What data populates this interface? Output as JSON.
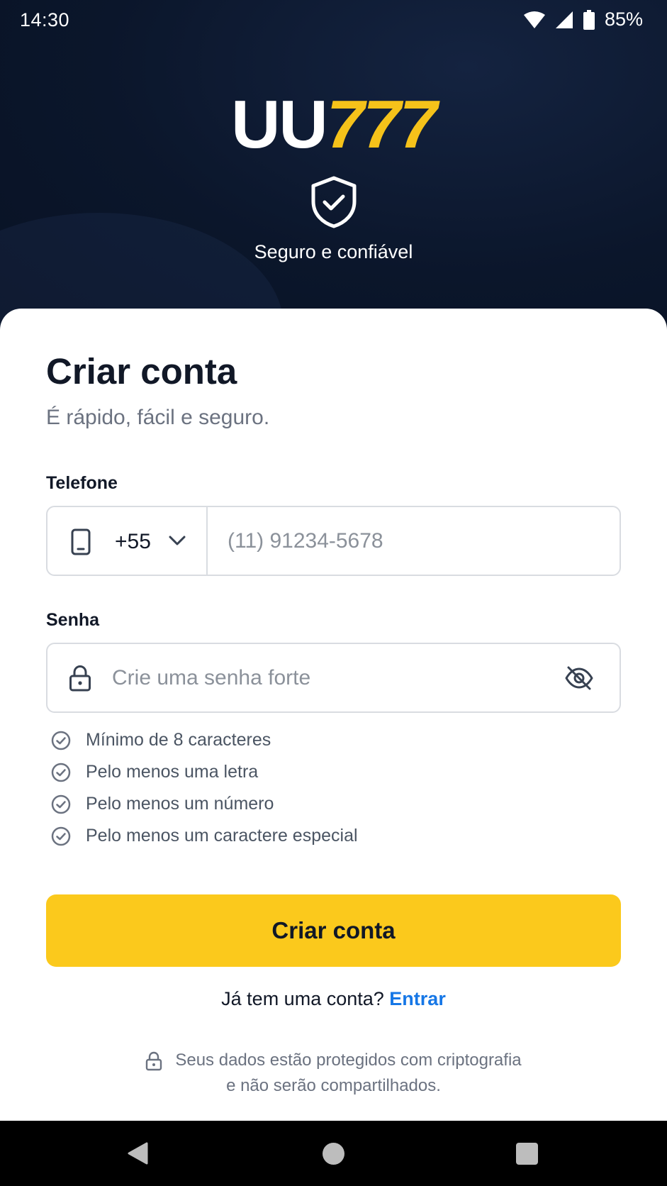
{
  "status_bar": {
    "time": "14:30",
    "battery": "85%",
    "icons": [
      "wifi-icon",
      "signal-icon",
      "battery-icon"
    ]
  },
  "header": {
    "logo_white": "UU",
    "logo_yellow": "777",
    "tagline": "Seguro e confiável",
    "icon": "shield-check-icon"
  },
  "form": {
    "title": "Criar conta",
    "subtitle": "É rápido, fácil e seguro.",
    "phone": {
      "label": "Telefone",
      "country_code": "+55",
      "placeholder": "(11) 91234-5678",
      "value": ""
    },
    "password": {
      "label": "Senha",
      "placeholder": "Crie uma senha forte",
      "value": ""
    },
    "rules": [
      "Mínimo de 8 caracteres",
      "Pelo menos uma letra",
      "Pelo menos um número",
      "Pelo menos um caractere especial"
    ],
    "submit_label": "Criar conta",
    "login_prompt": "Já tem uma conta?",
    "login_link": "Entrar",
    "privacy_line1": "Seus dados estão protegidos com criptografia",
    "privacy_line2": "e não serão compartilhados."
  },
  "colors": {
    "header_bg": "#0b162b",
    "accent_yellow": "#fbc91c",
    "link_blue": "#1677e6"
  }
}
